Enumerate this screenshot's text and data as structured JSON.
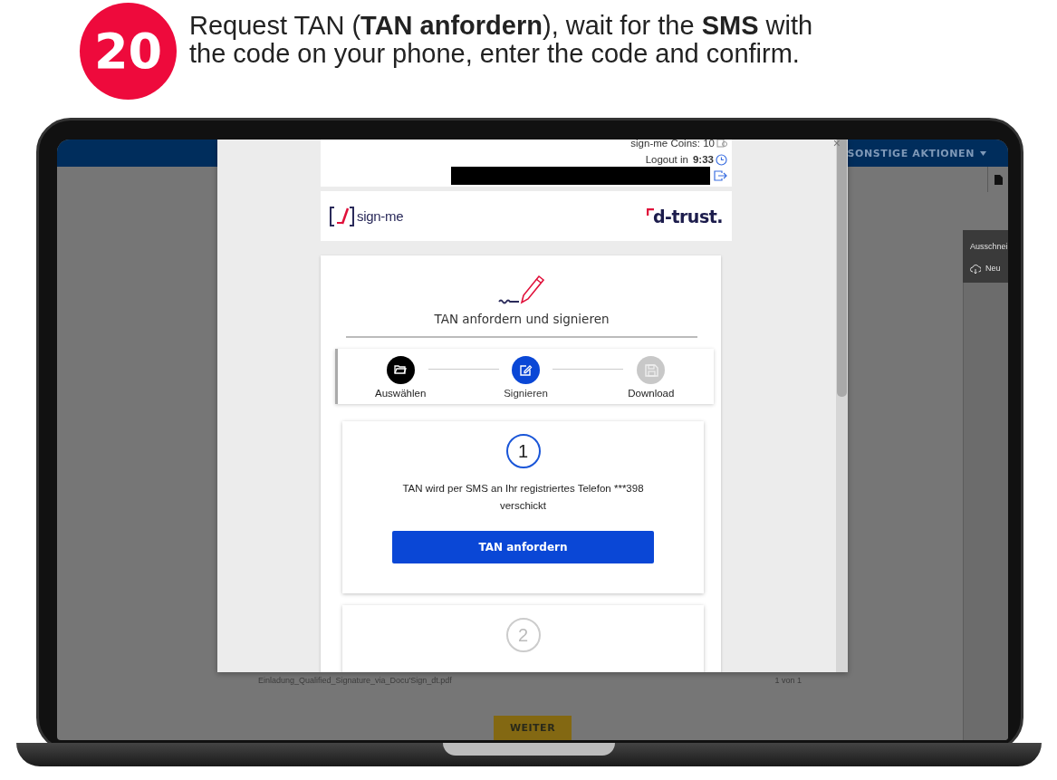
{
  "instruction": {
    "step_number": "20",
    "text": "Request TAN (**TAN anfordern**), wait for the **SMS** with the code on your phone, enter the code and confirm."
  },
  "app_bar": {
    "menu_label": "SONSTIGE AKTIONEN"
  },
  "side_menu": {
    "items": [
      {
        "kind": "text",
        "label": "Ausschnei"
      },
      {
        "kind": "icon",
        "label": "Neu"
      }
    ]
  },
  "document": {
    "file_name": "Einladung_Qualified_Signature_via_Docu'Sign_dt.pdf",
    "page_count": "1 von 1"
  },
  "continue_button": "WEITER",
  "dialog": {
    "close": "×",
    "account": {
      "coins": "sign-me Coins: 10",
      "logout_label": "Logout in",
      "logout_time": "9:33"
    },
    "brand_left": "sign-me",
    "brand_right": "d-trust.",
    "title": "TAN anfordern und signieren",
    "steps": [
      {
        "label": "Auswählen",
        "completed": true,
        "selected": false
      },
      {
        "label": "Signieren",
        "completed": false,
        "selected": true
      },
      {
        "label": "Download",
        "completed": false,
        "selected": false
      }
    ],
    "tan_cards": [
      {
        "number": "1",
        "active": true,
        "text": "TAN wird per SMS an Ihr registriertes Telefon ***398 verschickt",
        "button": "TAN anfordern"
      },
      {
        "number": "2",
        "active": false
      }
    ]
  }
}
